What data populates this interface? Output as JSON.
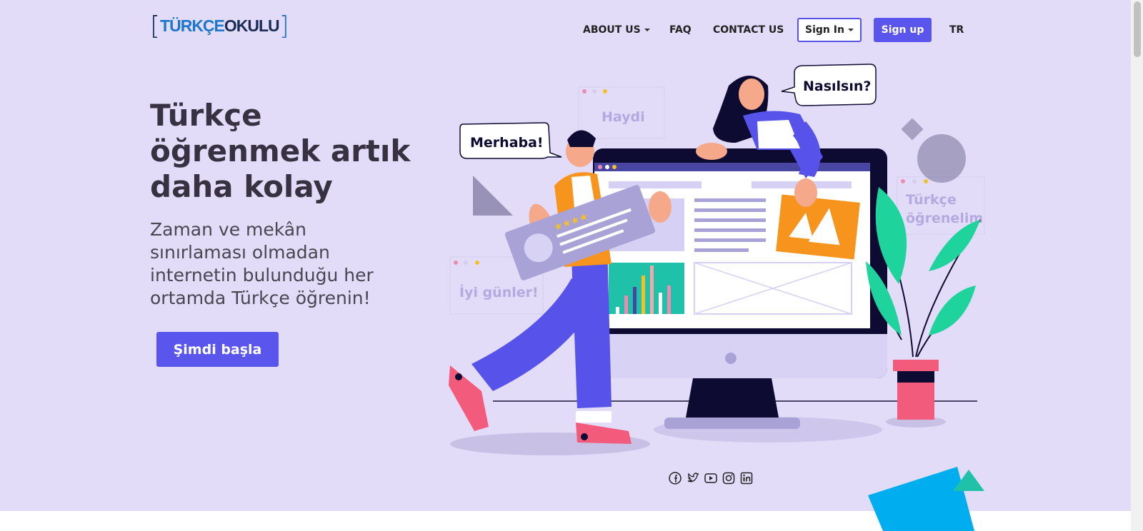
{
  "brand": {
    "logo_left": "TÜRKÇE",
    "logo_right": "OKULU"
  },
  "nav": {
    "about": "ABOUT US",
    "faq": "FAQ",
    "contact": "CONTACT US",
    "signin": "Sign In",
    "signup": "Sign up",
    "lang": "TR"
  },
  "hero": {
    "headline_1": "Türkçe",
    "headline_2": "öğrenmek artık",
    "headline_3": "daha kolay",
    "sub_1": "Zaman ve mekân",
    "sub_2": "sınırlaması olmadan",
    "sub_3": "internetin bulunduğu her",
    "sub_4": "ortamda Türkçe öğrenin!",
    "cta": "Şimdi başla"
  },
  "illustration": {
    "bubble_merhaba": "Merhaba!",
    "bubble_nasilsin": "Nasılsın?",
    "card_haydi": "Haydi",
    "card_iyi_gunler": "İyi günler!",
    "card_turkce_1": "Türkçe",
    "card_turkce_2": "öğrenelim"
  },
  "social": [
    "facebook-icon",
    "twitter-icon",
    "youtube-icon",
    "instagram-icon",
    "linkedin-icon"
  ],
  "colors": {
    "hero_bg": "#e3dcf8",
    "accent": "#5a55ec",
    "heading": "#373142",
    "logo_blue": "#1c76c9",
    "logo_dark": "#1a2c56"
  }
}
